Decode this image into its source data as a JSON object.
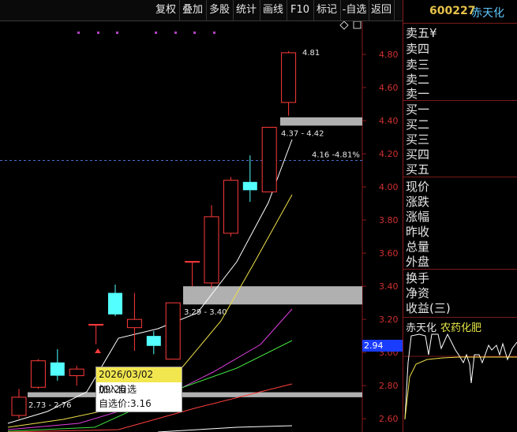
{
  "toolbar": {
    "buttons": [
      "复权",
      "叠加",
      "多股",
      "统计",
      "画线",
      "F10",
      "标记",
      "-自选",
      "返回"
    ]
  },
  "header": {
    "code": "600227",
    "name": "赤天化"
  },
  "quote": {
    "sell": [
      "卖五",
      "卖四",
      "卖三",
      "卖二",
      "卖一"
    ],
    "sell5_suffix": "¥",
    "buy": [
      "买一",
      "买二",
      "买三",
      "买四",
      "买五"
    ],
    "stats1": [
      "现价",
      "涨跌",
      "涨幅",
      "昨收",
      "总量",
      "外盘"
    ],
    "stats2": [
      "换手",
      "净资",
      "收益(三)"
    ]
  },
  "mini_chart": {
    "title": "赤天化",
    "sector": "农药化肥"
  },
  "price_tag": "2.94",
  "tooltip": {
    "datetime": "2026/03/02 09:26",
    "line1": "加入自选",
    "line2": "自选价:3.16"
  },
  "colors": {
    "up": "#ff3a3a",
    "down": "#54ffff",
    "accent": "#e6c24a",
    "zone": "#b0b0b0"
  },
  "chart_data": {
    "type": "candlestick",
    "y_axis_ticks": [
      "4.80",
      "4.60",
      "4.40",
      "4.20",
      "4.00",
      "3.80",
      "3.60",
      "3.40",
      "3.20",
      "3.00",
      "2.80",
      "2.60"
    ],
    "candles": [
      {
        "open": 2.62,
        "close": 2.73,
        "high": 2.78,
        "low": 2.6
      },
      {
        "open": 2.79,
        "close": 2.95,
        "high": 2.96,
        "low": 2.78
      },
      {
        "open": 2.94,
        "close": 2.86,
        "high": 3.02,
        "low": 2.83
      },
      {
        "open": 2.86,
        "close": 2.9,
        "high": 2.92,
        "low": 2.8
      },
      {
        "open": 3.17,
        "close": 3.17,
        "high": 3.17,
        "low": 3.05
      },
      {
        "open": 3.36,
        "close": 3.23,
        "high": 3.41,
        "low": 3.22
      },
      {
        "open": 3.15,
        "close": 3.2,
        "high": 3.36,
        "low": 3.01
      },
      {
        "open": 3.1,
        "close": 3.04,
        "high": 3.13,
        "low": 2.99
      },
      {
        "open": 2.96,
        "close": 3.3,
        "high": 3.3,
        "low": 2.96
      },
      {
        "open": 3.55,
        "close": 3.55,
        "high": 3.55,
        "low": 3.4
      },
      {
        "open": 3.42,
        "close": 3.82,
        "high": 3.89,
        "low": 3.39
      },
      {
        "open": 3.72,
        "close": 4.04,
        "high": 4.06,
        "low": 3.7
      },
      {
        "open": 4.03,
        "close": 3.98,
        "high": 4.19,
        "low": 3.91
      },
      {
        "open": 3.97,
        "close": 4.36,
        "high": 4.36,
        "low": 3.97
      },
      {
        "open": 4.51,
        "close": 4.81,
        "high": 4.82,
        "low": 4.43
      }
    ],
    "zones": [
      {
        "low": 4.37,
        "high": 4.42,
        "label": "4.37 - 4.42"
      },
      {
        "low": 3.29,
        "high": 3.4,
        "label": "3.29 - 3.40"
      },
      {
        "low": 2.73,
        "high": 2.76,
        "label": "2.73 - 2.76"
      }
    ],
    "current_line": {
      "value": 4.16,
      "label": "4.16 -4.81%"
    },
    "max_label": "4.81"
  }
}
